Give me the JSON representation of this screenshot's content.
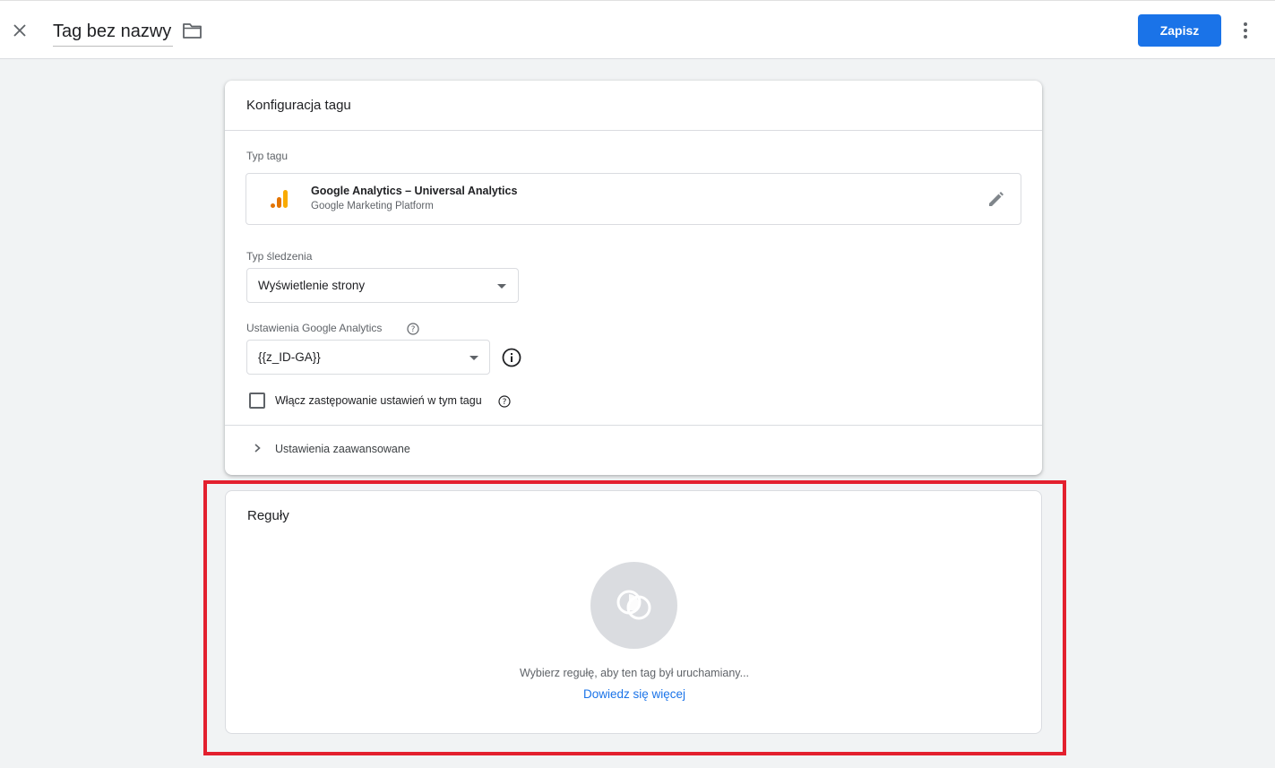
{
  "header": {
    "title": "Tag bez nazwy",
    "save_label": "Zapisz"
  },
  "config": {
    "title": "Konfiguracja tagu",
    "tag_type_label": "Typ tagu",
    "tag_type_name": "Google Analytics – Universal Analytics",
    "tag_type_provider": "Google Marketing Platform",
    "tracking_type_label": "Typ śledzenia",
    "tracking_type_value": "Wyświetlenie strony",
    "ga_settings_label": "Ustawienia Google Analytics",
    "ga_settings_value": "{{z_ID-GA}}",
    "override_label": "Włącz zastępowanie ustawień w tym tagu",
    "override_checked": false,
    "advanced_label": "Ustawienia zaawansowane"
  },
  "rules": {
    "title": "Reguły",
    "hint": "Wybierz regułę, aby ten tag był uruchamiany...",
    "learn_more": "Dowiedz się więcej"
  },
  "colors": {
    "accent": "#1a73e8",
    "highlight": "#e3202e",
    "ga_orange": "#f9ab00",
    "ga_dark_orange": "#e37400"
  },
  "icons": {
    "close": "close-icon",
    "folder": "folder-icon",
    "more": "more-vert-icon",
    "edit": "pencil-icon",
    "help": "help-circle-icon",
    "info": "info-icon",
    "chevron": "chevron-right-icon",
    "triggers": "trigger-circles-icon"
  }
}
